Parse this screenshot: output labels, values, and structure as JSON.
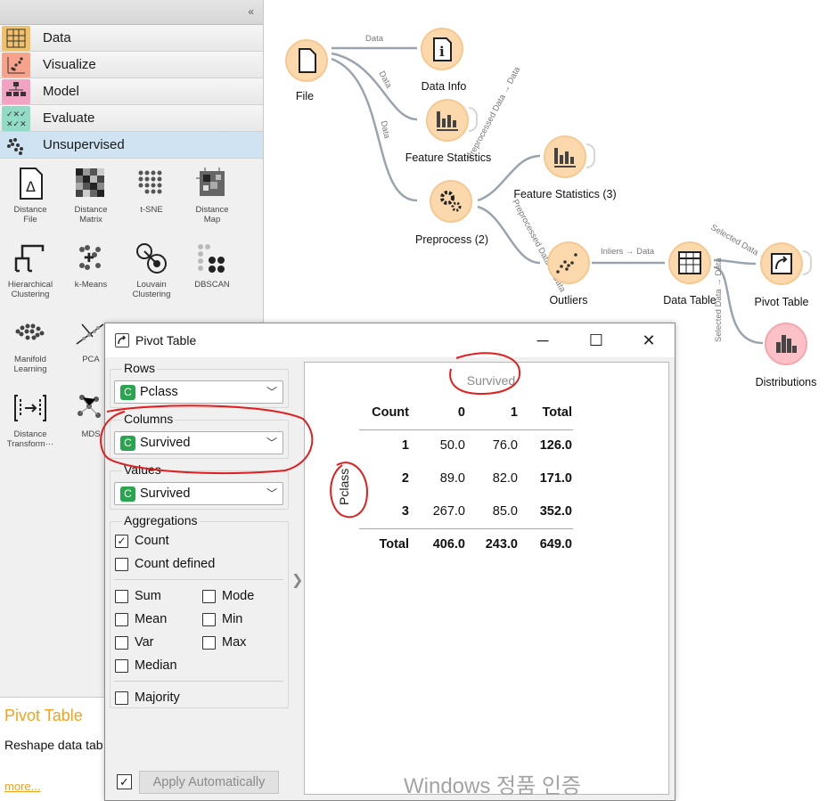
{
  "toolbox": {
    "categories": [
      {
        "label": "Data",
        "color": "#f1c06b"
      },
      {
        "label": "Visualize",
        "color": "#f7a28a"
      },
      {
        "label": "Model",
        "color": "#f2a3c4"
      },
      {
        "label": "Evaluate",
        "color": "#92dbc6"
      },
      {
        "label": "Unsupervised",
        "color": "#cde3f2"
      }
    ],
    "widgets": [
      {
        "label": "Distance File",
        "line1": "Distance",
        "line2": "File"
      },
      {
        "label": "Distance Matrix",
        "line1": "Distance",
        "line2": "Matrix"
      },
      {
        "label": "t-SNE",
        "line1": "t-SNE",
        "line2": ""
      },
      {
        "label": "Distance Map",
        "line1": "Distance",
        "line2": "Map"
      },
      {
        "label": "Hierarchical Clustering",
        "line1": "Hierarchical",
        "line2": "Clustering"
      },
      {
        "label": "k-Means",
        "line1": "k-Means",
        "line2": ""
      },
      {
        "label": "Louvain Clustering",
        "line1": "Louvain",
        "line2": "Clustering"
      },
      {
        "label": "DBSCAN",
        "line1": "DBSCAN",
        "line2": ""
      },
      {
        "label": "Manifold Learning",
        "line1": "Manifold",
        "line2": "Learning"
      },
      {
        "label": "PCA",
        "line1": "PCA",
        "line2": ""
      },
      {
        "label": "Distance Transformation",
        "line1": "Distance",
        "line2": "Transform···"
      },
      {
        "label": "MDS",
        "line1": "MDS",
        "line2": ""
      }
    ],
    "help": {
      "title": "Pivot Table",
      "description": "Reshape data tab values.",
      "more": "more..."
    }
  },
  "canvas": {
    "nodes": {
      "file": "File",
      "data_info": "Data Info",
      "feature_statistics": "Feature Statistics",
      "feature_statistics_3": "Feature Statistics (3)",
      "preprocess": "Preprocess (2)",
      "outliers": "Outliers",
      "data_table": "Data Table",
      "pivot_table": "Pivot Table",
      "distributions": "Distributions"
    },
    "links": {
      "file_to_info": "Data",
      "file_to_fs": "Data",
      "file_to_pre": "Data",
      "pre_to_fs3": "Preprocessed Data → Data",
      "pre_to_outliers": "Preprocessed Data → Data",
      "outliers_to_table": "Inliers → Data",
      "table_to_pivot": "Selected Data → Data",
      "table_to_dist": "Selected Data → Data"
    }
  },
  "dialog": {
    "title": "Pivot Table",
    "minimize": "─",
    "maximize": "☐",
    "close": "✕",
    "rows": {
      "label": "Rows",
      "value": "Pclass",
      "badge": "C"
    },
    "columns": {
      "label": "Columns",
      "value": "Survived",
      "badge": "C"
    },
    "values": {
      "label": "Values",
      "value": "Survived",
      "badge": "C"
    },
    "aggregations": {
      "label": "Aggregations",
      "count": {
        "label": "Count",
        "checked": true
      },
      "count_defined": {
        "label": "Count defined",
        "checked": false
      },
      "sum": {
        "label": "Sum",
        "checked": false
      },
      "mode": {
        "label": "Mode",
        "checked": false
      },
      "mean": {
        "label": "Mean",
        "checked": false
      },
      "min": {
        "label": "Min",
        "checked": false
      },
      "var": {
        "label": "Var",
        "checked": false
      },
      "max": {
        "label": "Max",
        "checked": false
      },
      "median": {
        "label": "Median",
        "checked": false
      },
      "majority": {
        "label": "Majority",
        "checked": false
      }
    },
    "apply_auto": {
      "label": "Apply Automatically",
      "checked": true
    }
  },
  "pivot": {
    "col_var": "Survived",
    "row_var": "Pclass",
    "header": [
      "Count",
      "0",
      "1",
      "Total"
    ],
    "rows": [
      {
        "label": "1",
        "v0": "50.0",
        "v1": "76.0",
        "total": "126.0"
      },
      {
        "label": "2",
        "v0": "89.0",
        "v1": "82.0",
        "total": "171.0"
      },
      {
        "label": "3",
        "v0": "267.0",
        "v1": "85.0",
        "total": "352.0"
      }
    ],
    "totals": {
      "label": "Total",
      "v0": "406.0",
      "v1": "243.0",
      "total": "649.0"
    }
  },
  "watermark": "Windows 정품 인증"
}
